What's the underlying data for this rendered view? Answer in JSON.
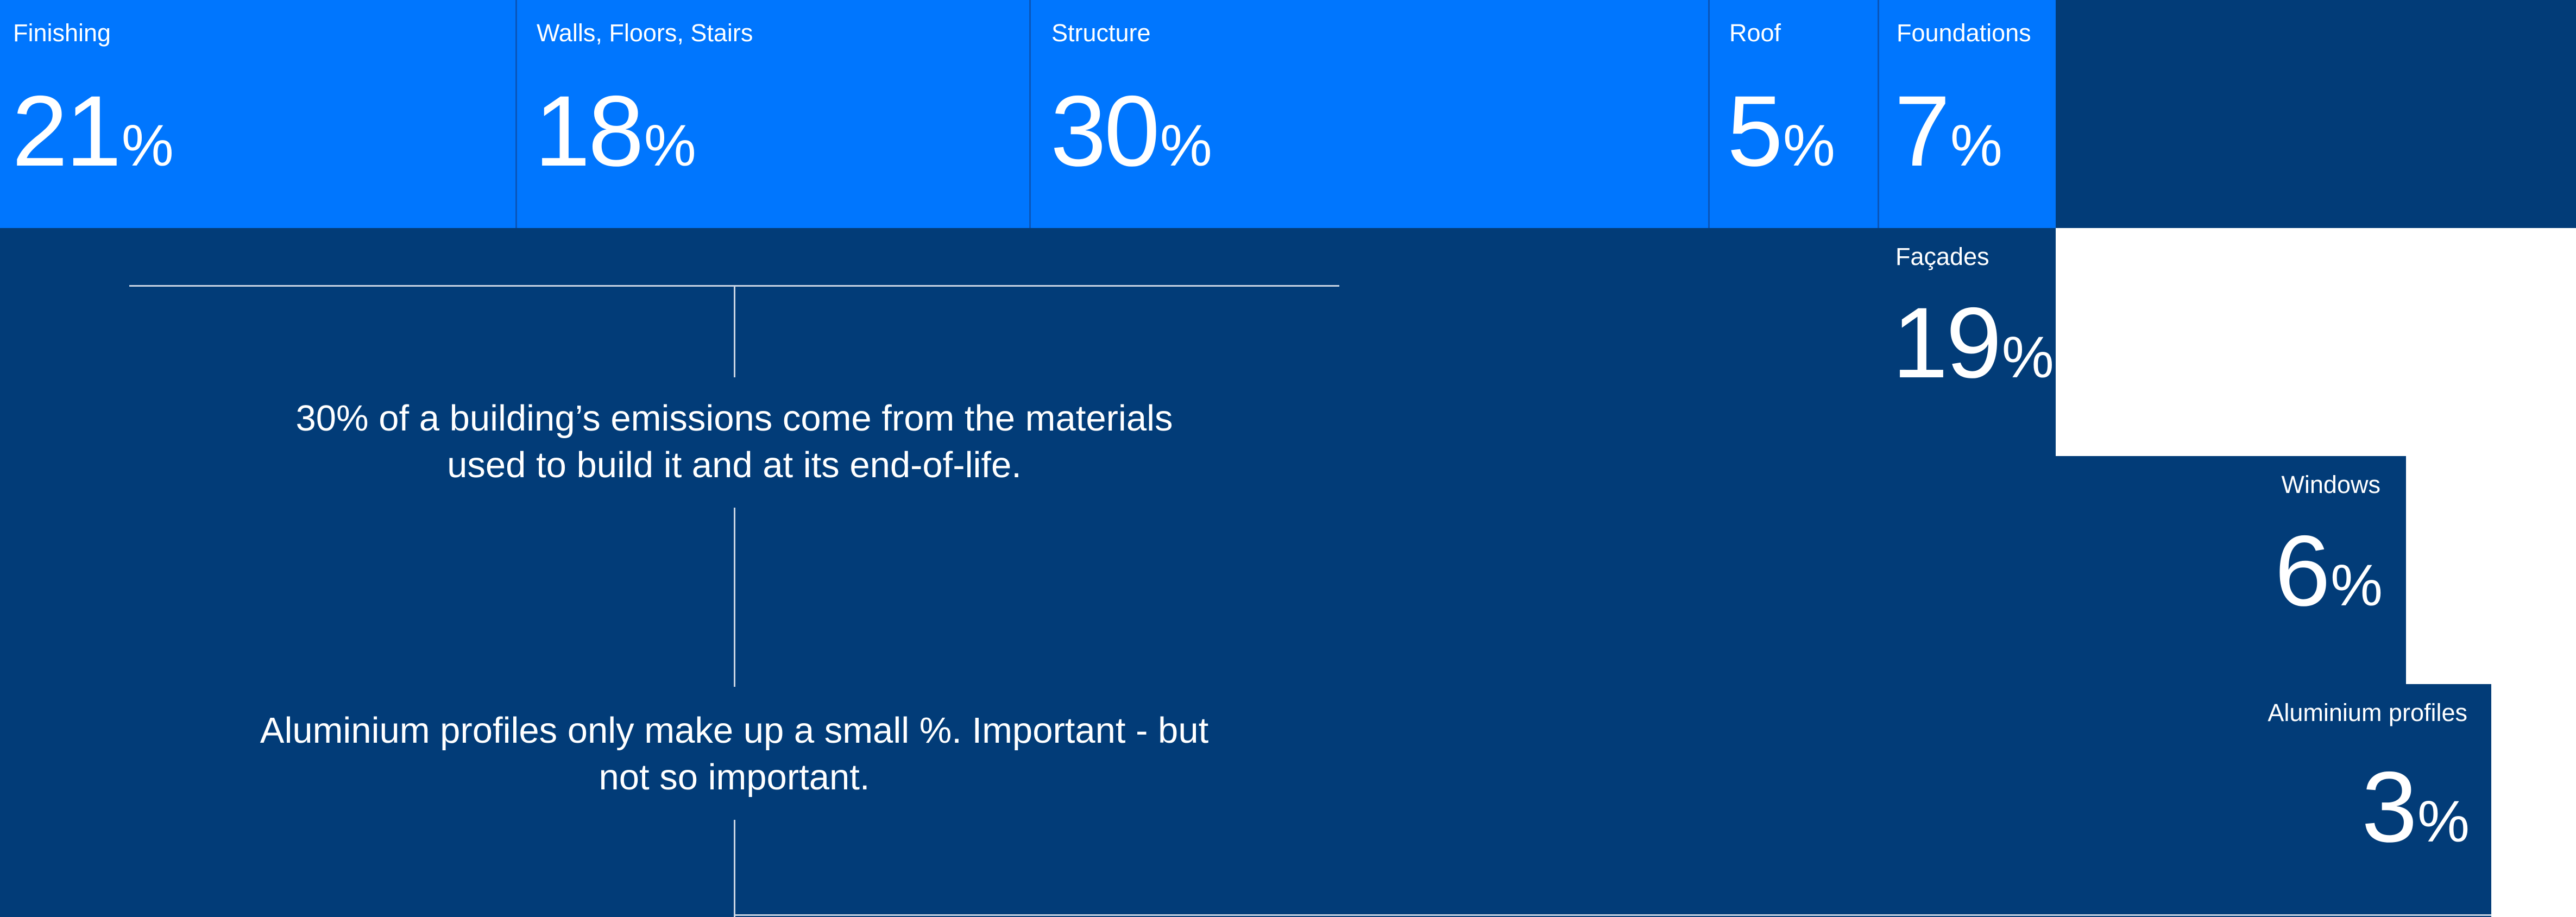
{
  "chart_data": {
    "type": "treemap",
    "unit": "%",
    "categories": [
      {
        "name": "Finishing",
        "value": 21
      },
      {
        "name": "Walls, Floors, Stairs",
        "value": 18
      },
      {
        "name": "Structure",
        "value": 30
      },
      {
        "name": "Roof",
        "value": 5
      },
      {
        "name": "Foundations",
        "value": 7
      },
      {
        "name": "Façades",
        "value": 19
      },
      {
        "name": "Windows",
        "value": 6
      },
      {
        "name": "Aluminium profiles",
        "value": 3
      }
    ],
    "percent_sign": "%",
    "annotations": [
      "30% of a building’s emissions come from the materials used to build it and at its end-of-life.",
      "Aluminium profiles only make up a small %. Important - but not so important."
    ]
  },
  "colors": {
    "background": "#023c78",
    "accent": "#0076fe",
    "highlight": "#ffffff"
  }
}
